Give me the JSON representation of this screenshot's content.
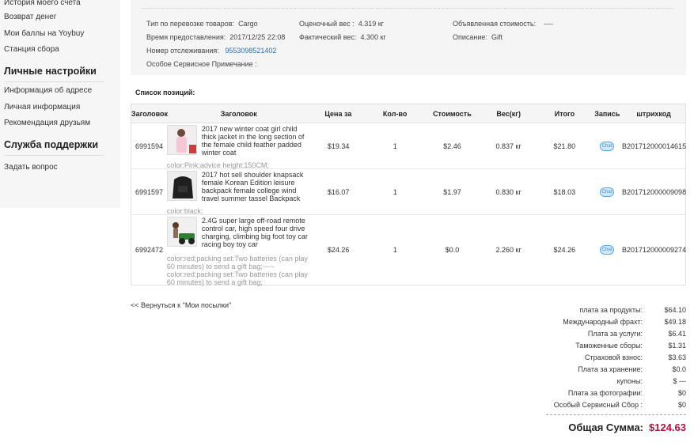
{
  "sidebar": {
    "items_top": [
      "История моего счета",
      "Возврат денег",
      "Мои баллы на Yoybuy",
      "Станция сбора"
    ],
    "section_personal": "Личные настройки",
    "items_personal": [
      "Информация об адресе",
      "Личная информация",
      "Рекомендация друзьям"
    ],
    "section_support": "Служба поддержки",
    "items_support": [
      "Задать вопрос"
    ]
  },
  "shipment": {
    "type_label": "Тип по перевозке товаров:",
    "type_value": "Cargo",
    "est_weight_label": "Оценочный вес :",
    "est_weight_value": "4.319 кг",
    "declared_label": "Объявленная стоимость:",
    "declared_value": "----",
    "time_label": "Время предоставления:",
    "time_value": "2017/12/25 22:08",
    "act_weight_label": "Фактический вес:",
    "act_weight_value": "4.300 кг",
    "desc_label": "Описание:",
    "desc_value": "Gift",
    "tracking_label": "Номер отслеживания:",
    "tracking_value": "9553098521402",
    "note_label": "Особое Сервисное Примечание :"
  },
  "items_title": "Список позиций:",
  "table": {
    "headers": [
      "Заголовок",
      "Заголовок",
      "Цена за",
      "Кол-во",
      "Стоимость",
      "Вес(кг)",
      "Итого",
      "Запись",
      "штрихкод"
    ],
    "chat_label": "Chat",
    "rows": [
      {
        "id": "6991594",
        "title": "2017 new winter coat girl child thick jacket in the long section of the female child feather padded winter coat",
        "attr": "color:Pink;advice height:150CM;",
        "price": "$19.34",
        "qty": "1",
        "cost": "$2.46",
        "weight": "0.837 кг",
        "total": "$21.80",
        "barcode": "B201712000014615"
      },
      {
        "id": "6991597",
        "title": "2017 hot sell shoulder knapsack female Korean Edition leisure backpack female college wind travel summer tassel Backpack",
        "attr": "color:black;",
        "price": "$16.07",
        "qty": "1",
        "cost": "$1.97",
        "weight": "0.830 кг",
        "total": "$18.03",
        "barcode": "B201712000009098"
      },
      {
        "id": "6992472",
        "title": "2.4G super large off-road remote control car, high speed four drive charging, climbing big foot toy car racing boy toy car",
        "attr": "color:red;packing set:Two batteries (can play 60 minutes) to send a gift bag;-----color:red;packing set:Two batteries (can play 60 minutes) to send a gift bag;",
        "price": "$24.26",
        "qty": "1",
        "cost": "$0.0",
        "weight": "2.260 кг",
        "total": "$24.26",
        "barcode": "B201712000009274"
      }
    ]
  },
  "back_link": "<< Вернуться к \"Мои посылки\"",
  "fees": [
    {
      "label": "плата за продукты:",
      "value": "$64.10"
    },
    {
      "label": "Международный фрахт:",
      "value": "$49.18"
    },
    {
      "label": "Плата за услуги:",
      "value": "$6.41"
    },
    {
      "label": "Таможенные сборы:",
      "value": "$1.31"
    },
    {
      "label": "Страховой взнос:",
      "value": "$3.63"
    },
    {
      "label": "Плата за хранение:",
      "value": "$0.0"
    },
    {
      "label": "купоны:",
      "value": "$ ---"
    },
    {
      "label": "Плата за фотографии:",
      "value": "$0"
    },
    {
      "label": "Особый Сервисный Сбор :",
      "value": "$0"
    }
  ],
  "total": {
    "label": "Общая Сумма:",
    "value": "$124.63"
  },
  "colors": {
    "accent_link": "#2a6fb5",
    "total_red": "#b0133d",
    "chat_blue": "#59a8e6"
  }
}
